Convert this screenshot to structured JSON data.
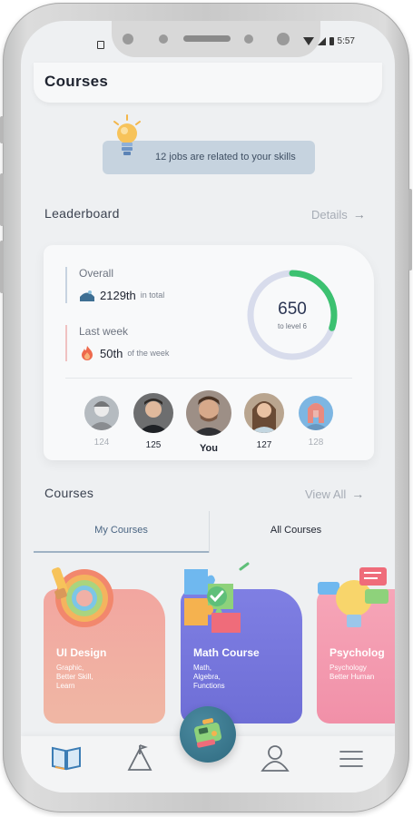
{
  "status": {
    "time": "5:57"
  },
  "header": {
    "title": "Courses"
  },
  "jobs_banner": {
    "text": "12 jobs are related to your skills"
  },
  "leaderboard": {
    "title": "Leaderboard",
    "details_label": "Details",
    "overall": {
      "label": "Overall",
      "value": "2129th",
      "sub": "in total"
    },
    "last_week": {
      "label": "Last week",
      "value": "50th",
      "sub": "of the week"
    },
    "points": {
      "value": "650",
      "sub": "to level 6",
      "progress_percent": 30
    },
    "ranks": [
      {
        "label": "124"
      },
      {
        "label": "125"
      },
      {
        "label": "You"
      },
      {
        "label": "127"
      },
      {
        "label": "128"
      }
    ]
  },
  "courses": {
    "title": "Courses",
    "view_all_label": "View All",
    "tabs": {
      "my": "My Courses",
      "all": "All Courses"
    },
    "items": [
      {
        "title": "UI Design",
        "desc": "Graphic,\nBetter Skill,\nLearn"
      },
      {
        "title": "Math Course",
        "desc": "Math,\nAlgebra,\nFunctions"
      },
      {
        "title": "Psycholog",
        "desc": "Psychology\nBetter Human"
      }
    ]
  },
  "nav": {
    "icons": [
      "book-icon",
      "flag-icon",
      "game-controller-icon",
      "user-icon",
      "menu-icon"
    ]
  },
  "colors": {
    "accent_green": "#3cc170",
    "gauge_track": "#d8dcec",
    "tab_active": "#4a6583"
  }
}
